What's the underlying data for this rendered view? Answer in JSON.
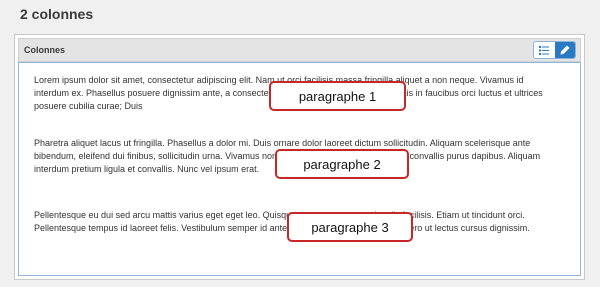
{
  "page": {
    "title": "2 colonnes"
  },
  "block": {
    "title": "Colonnes"
  },
  "toolbar": {
    "list_icon": "list-icon",
    "edit_icon": "pencil-icon",
    "active_color": "#2a79c4"
  },
  "paragraphs": [
    "Lorem ipsum dolor sit amet, consectetur adipiscing elit. Nam ut orci facilisis massa fringilla aliquet a non neque. Vivamus id interdum ex. Phasellus posuere dignissim ante, a consectetur ex. Vestibulum ante ipsum primis in faucibus orci luctus et ultrices posuere cubilia curae; Duis",
    "Pharetra aliquet lacus ut fringilla. Phasellus a dolor mi. Duis ornare dolor laoreet dictum sollicitudin. Aliquam scelerisque ante bibendum, eleifend dui finibus, sollicitudin urna. Vivamus non sem non metus pellentesque, et convallis purus dapibus. Aliquam interdum pretium ligula et convallis. Nunc vel ipsum erat.",
    "Pellentesque eu dui sed arcu mattis varius eget eget leo. Quisque consequat eros ac iaculis facilisis. Etiam ut tincidunt orci. Pellentesque tempus id laoreet felis. Vestibulum semper id ante sed elementum. Fusce nec libero ut lectus cursus dignissim."
  ],
  "callouts": [
    "paragraphe 1",
    "paragraphe 2",
    "paragraphe 3"
  ],
  "callout_color": "#c62828"
}
